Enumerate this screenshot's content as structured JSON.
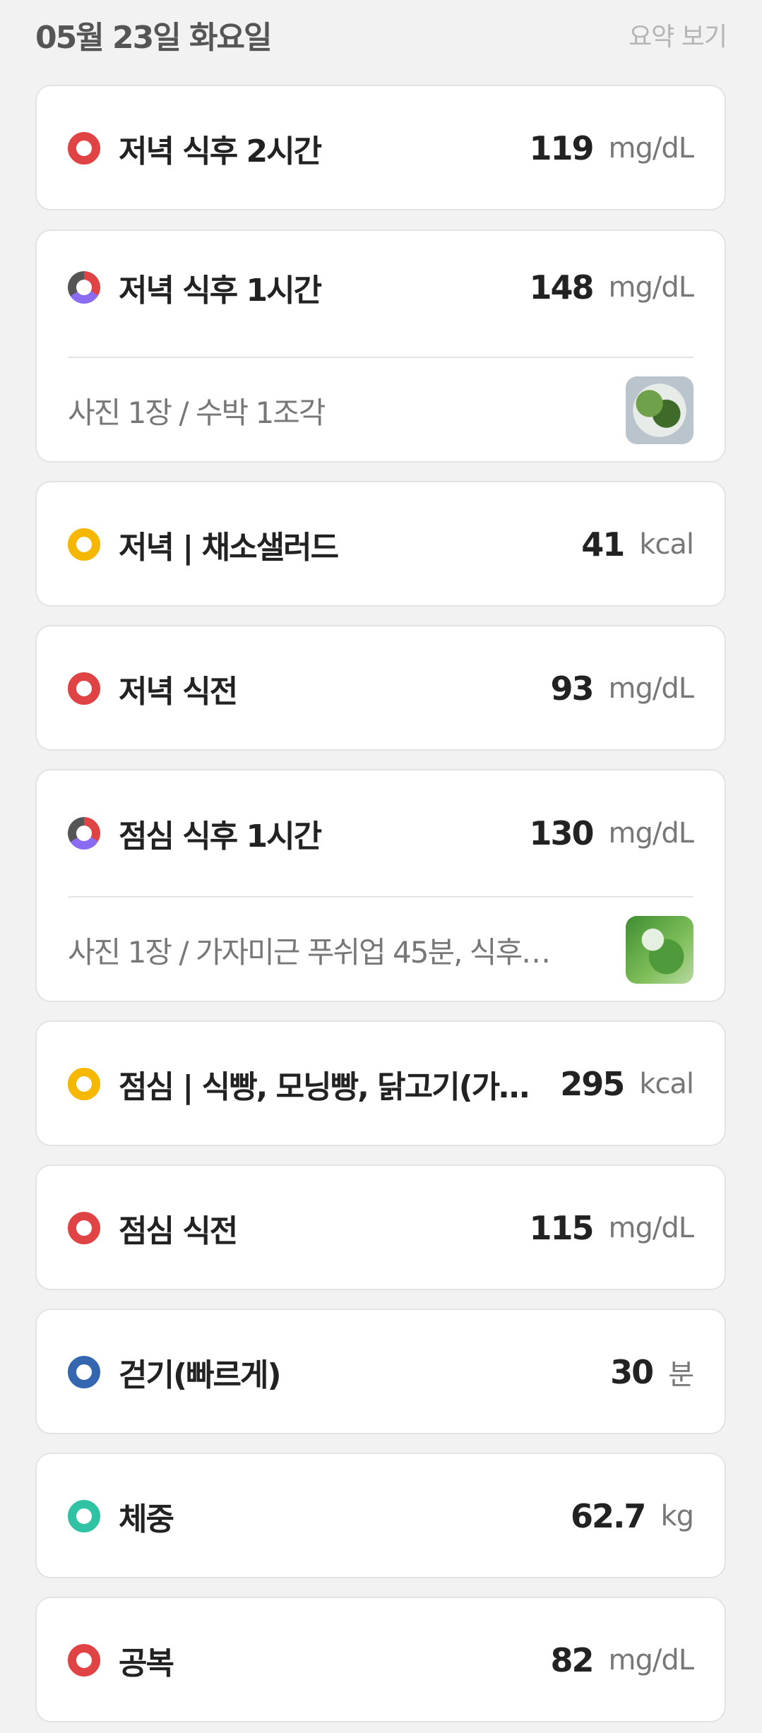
{
  "header": {
    "date": "05월 23일 화요일",
    "summary_link": "요약 보기"
  },
  "entries": [
    {
      "title": "저녁 식후 2시간",
      "value": "119",
      "unit": "mg/dL",
      "dot": "red"
    },
    {
      "title": "저녁 식후 1시간",
      "value": "148",
      "unit": "mg/dL",
      "dot": "multi",
      "note": "사진 1장 / 수박 1조각",
      "thumb_icon": "salad-photo"
    },
    {
      "title": "저녁 | 채소샐러드",
      "value": "41",
      "unit": "kcal",
      "dot": "yellow"
    },
    {
      "title": "저녁 식전",
      "value": "93",
      "unit": "mg/dL",
      "dot": "red"
    },
    {
      "title": "점심 식후 1시간",
      "value": "130",
      "unit": "mg/dL",
      "dot": "multi",
      "note": "사진 1장 / 가자미근 푸쉬업 45분, 식후…",
      "thumb_icon": "lunch-photo"
    },
    {
      "title": "점심 | 식빵, 모닝빵, 닭고기(가…",
      "value": "295",
      "unit": "kcal",
      "dot": "yellow"
    },
    {
      "title": "점심 식전",
      "value": "115",
      "unit": "mg/dL",
      "dot": "red"
    },
    {
      "title": "걷기(빠르게)",
      "value": "30",
      "unit": "분",
      "dot": "blue"
    },
    {
      "title": "체중",
      "value": "62.7",
      "unit": "kg",
      "dot": "teal"
    },
    {
      "title": "공복",
      "value": "82",
      "unit": "mg/dL",
      "dot": "red"
    }
  ],
  "colors": {
    "red": "#e04343",
    "yellow": "#f6b700",
    "blue": "#3566b0",
    "teal": "#2fc3a3",
    "purple": "#8b6cf0"
  }
}
